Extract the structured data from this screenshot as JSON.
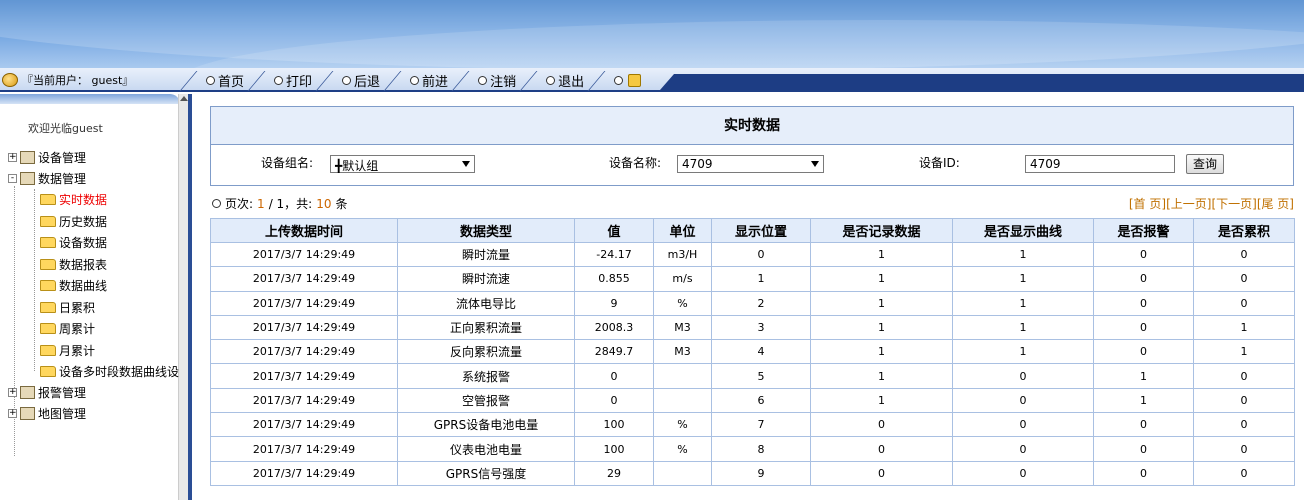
{
  "user": {
    "label": "『当前用户： guest』"
  },
  "nav": [
    {
      "label": "首页"
    },
    {
      "label": "打印"
    },
    {
      "label": "后退"
    },
    {
      "label": "前进"
    },
    {
      "label": "注销"
    },
    {
      "label": "退出"
    },
    {
      "label": ""
    }
  ],
  "sidebar": {
    "welcome": "欢迎光临guest",
    "items": [
      {
        "label": "设备管理"
      },
      {
        "label": "数据管理"
      },
      {
        "label": "实时数据"
      },
      {
        "label": "历史数据"
      },
      {
        "label": "设备数据"
      },
      {
        "label": "数据报表"
      },
      {
        "label": "数据曲线"
      },
      {
        "label": "日累积"
      },
      {
        "label": "周累计"
      },
      {
        "label": "月累计"
      },
      {
        "label": "设备多时段数据曲线设"
      },
      {
        "label": "报警管理"
      },
      {
        "label": "地图管理"
      }
    ]
  },
  "main": {
    "title": "实时数据",
    "group_label": "设备组名:",
    "group_value": "╋默认组",
    "device_label": "设备名称:",
    "device_value": "4709",
    "id_label": "设备ID:",
    "id_value": "4709",
    "query_label": "查询",
    "page_prefix": "页次:",
    "page_current": "1",
    "page_sep": "/ 1，共:",
    "page_count": "10",
    "page_suffix": "条",
    "pager": [
      "[首 页]",
      "[上一页]",
      "[下一页]",
      "[尾 页]"
    ]
  },
  "table": {
    "headers": [
      "上传数据时间",
      "数据类型",
      "值",
      "单位",
      "显示位置",
      "是否记录数据",
      "是否显示曲线",
      "是否报警",
      "是否累积"
    ],
    "rows": [
      [
        "2017/3/7 14:29:49",
        "瞬时流量",
        "-24.17",
        "m3/H",
        "0",
        "1",
        "1",
        "0",
        "0"
      ],
      [
        "2017/3/7 14:29:49",
        "瞬时流速",
        "0.855",
        "m/s",
        "1",
        "1",
        "1",
        "0",
        "0"
      ],
      [
        "2017/3/7 14:29:49",
        "流体电导比",
        "9",
        "%",
        "2",
        "1",
        "1",
        "0",
        "0"
      ],
      [
        "2017/3/7 14:29:49",
        "正向累积流量",
        "2008.3",
        "M3",
        "3",
        "1",
        "1",
        "0",
        "1"
      ],
      [
        "2017/3/7 14:29:49",
        "反向累积流量",
        "2849.7",
        "M3",
        "4",
        "1",
        "1",
        "0",
        "1"
      ],
      [
        "2017/3/7 14:29:49",
        "系统报警",
        "0",
        "",
        "5",
        "1",
        "0",
        "1",
        "0"
      ],
      [
        "2017/3/7 14:29:49",
        "空管报警",
        "0",
        "",
        "6",
        "1",
        "0",
        "1",
        "0"
      ],
      [
        "2017/3/7 14:29:49",
        "GPRS设备电池电量",
        "100",
        "%",
        "7",
        "0",
        "0",
        "0",
        "0"
      ],
      [
        "2017/3/7 14:29:49",
        "仪表电池电量",
        "100",
        "%",
        "8",
        "0",
        "0",
        "0",
        "0"
      ],
      [
        "2017/3/7 14:29:49",
        "GPRS信号强度",
        "29",
        "",
        "9",
        "0",
        "0",
        "0",
        "0"
      ]
    ]
  }
}
